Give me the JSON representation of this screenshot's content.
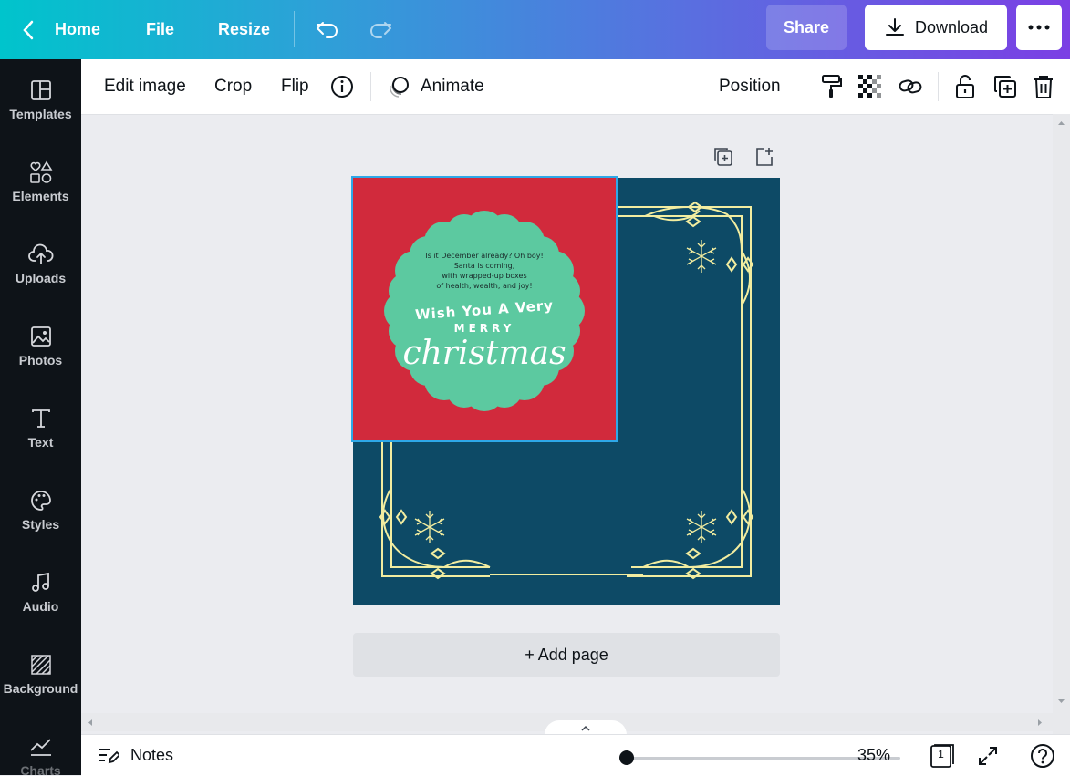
{
  "topbar": {
    "home": "Home",
    "file": "File",
    "resize": "Resize",
    "share": "Share",
    "download": "Download"
  },
  "sidebar": {
    "items": [
      {
        "label": "Templates",
        "icon": "templates-icon"
      },
      {
        "label": "Elements",
        "icon": "elements-icon"
      },
      {
        "label": "Uploads",
        "icon": "upload-icon"
      },
      {
        "label": "Photos",
        "icon": "photos-icon"
      },
      {
        "label": "Text",
        "icon": "text-icon"
      },
      {
        "label": "Styles",
        "icon": "palette-icon"
      },
      {
        "label": "Audio",
        "icon": "music-icon"
      },
      {
        "label": "Background",
        "icon": "background-icon"
      },
      {
        "label": "Charts",
        "icon": "chart-icon"
      }
    ]
  },
  "toolbar": {
    "edit_image": "Edit image",
    "crop": "Crop",
    "flip": "Flip",
    "animate": "Animate",
    "position": "Position"
  },
  "design": {
    "poem_line1": "Is it December already? Oh boy!",
    "poem_line2": "Santa is coming,",
    "poem_line3": "with wrapped-up boxes",
    "poem_line4": "of health, wealth, and joy!",
    "wish": "Wish You A Very",
    "merry": "MERRY",
    "christmas": "christmas",
    "page_bg": "#0d4a66",
    "panel_bg": "#d12a3c",
    "badge_bg": "#5cc9a0",
    "frame_color": "#f2eda0"
  },
  "canvas": {
    "add_page": "+ Add page"
  },
  "bottombar": {
    "notes": "Notes",
    "zoom": "35%",
    "page_count": "1"
  }
}
